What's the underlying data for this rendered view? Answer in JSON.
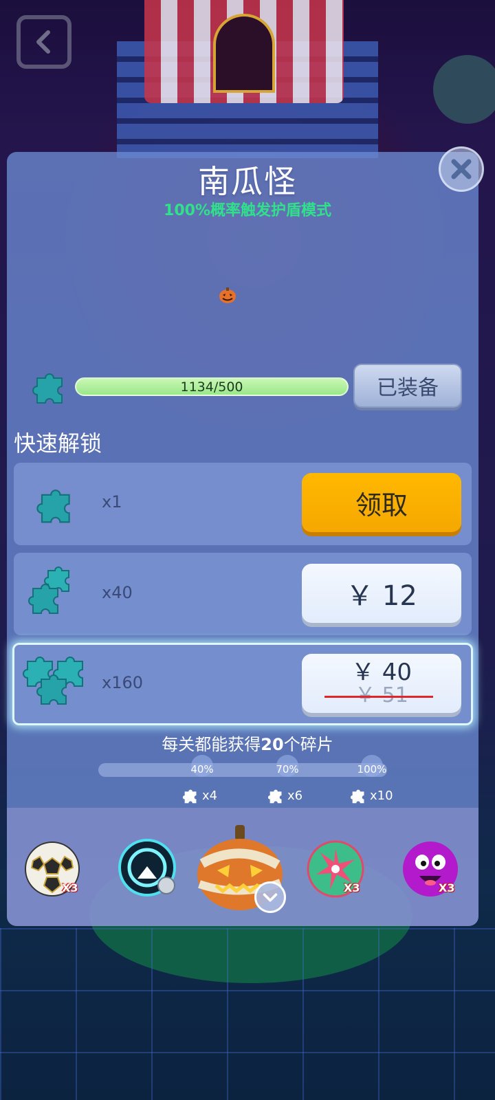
{
  "header": {
    "back_icon": "back-arrow-icon"
  },
  "skin_detail": {
    "name": "南瓜怪",
    "effect": "100%概率触发护盾模式",
    "progress_text": "1134/500",
    "progress_fraction": 1.0,
    "equip_label": "已装备",
    "close_icon": "close-icon"
  },
  "quick_unlock": {
    "title": "快速解锁",
    "offers": [
      {
        "qty": "x1",
        "action": "领取",
        "action_color": "#ffb800"
      },
      {
        "qty": "x40",
        "price": "￥ 12"
      },
      {
        "qty": "x160",
        "price": "￥ 40",
        "original_price": "￥ 51"
      }
    ]
  },
  "level_rewards": {
    "tip_prefix": "每关都能获得",
    "tip_count": "20",
    "tip_suffix": "个碎片",
    "milestones": [
      {
        "label": "40%",
        "reward": "x4"
      },
      {
        "label": "70%",
        "reward": "x6"
      },
      {
        "label": "100%",
        "reward": "x10"
      }
    ]
  },
  "skins": [
    {
      "name": "soccer-ball",
      "badge": "X3"
    },
    {
      "name": "robot-ball",
      "badge": ""
    },
    {
      "name": "pumpkin-monster",
      "badge": "",
      "equipped": true
    },
    {
      "name": "firework-ball",
      "badge": "X3"
    },
    {
      "name": "purple-smiley-ball",
      "badge": "X3"
    }
  ],
  "colors": {
    "accent_green": "#31e08a",
    "claim_orange": "#ffb800",
    "strike_red": "#e1262a"
  }
}
